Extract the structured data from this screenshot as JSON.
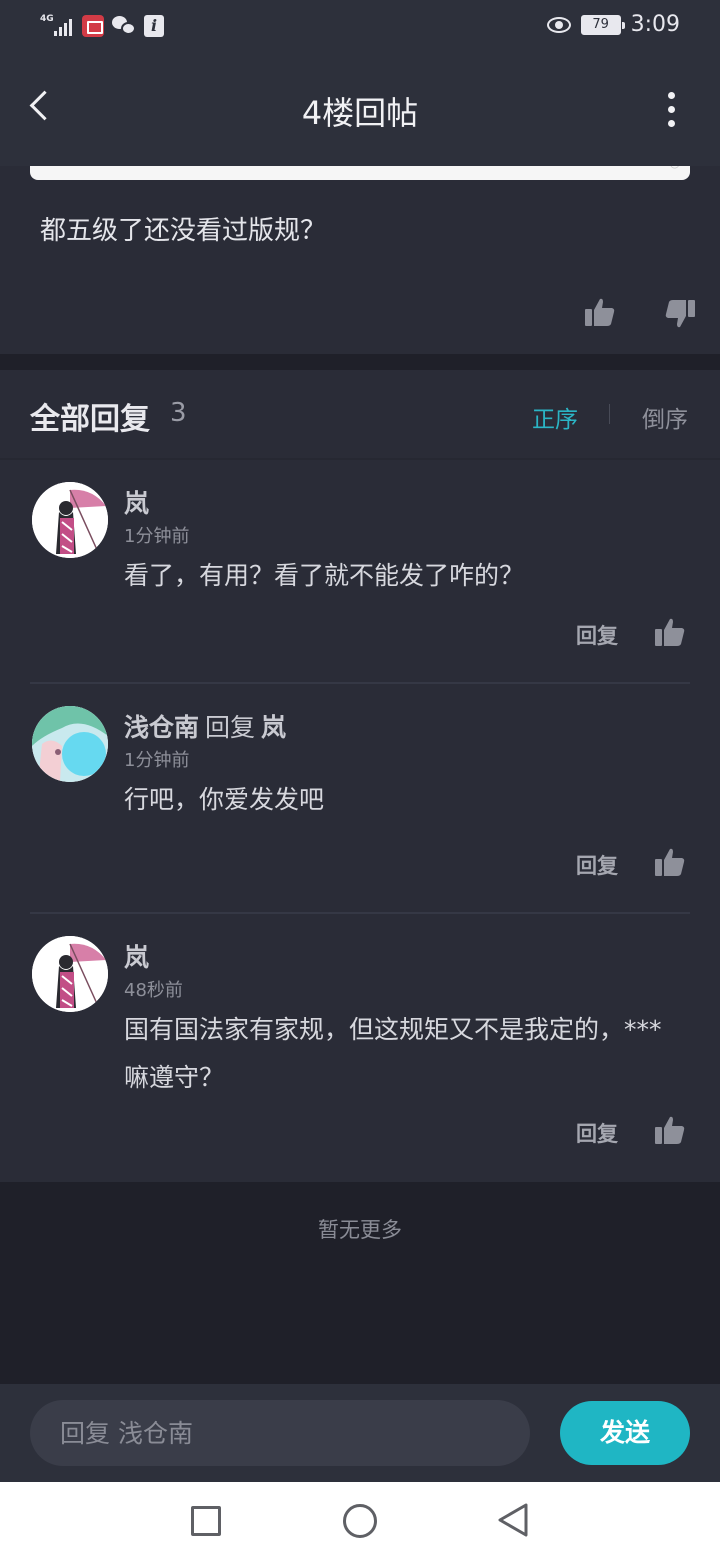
{
  "status_bar": {
    "network": "4G",
    "battery": "79",
    "time": "3:09"
  },
  "header": {
    "title": "4楼回帖"
  },
  "post": {
    "text": "都五级了还没看过版规？"
  },
  "replies_section": {
    "label": "全部回复",
    "count": "3",
    "sort_asc": "正序",
    "sort_desc": "倒序"
  },
  "replies": [
    {
      "author": "岚",
      "reply_to_word": "",
      "reply_to": "",
      "time": "1分钟前",
      "text": "看了，有用？看了就不能发了咋的？",
      "reply_label": "回复",
      "avatar_icon": "anime-girl-umbrella-avatar"
    },
    {
      "author": "浅仓南",
      "reply_to_word": "回复",
      "reply_to": "岚",
      "time": "1分钟前",
      "text": "行吧，你爱发发吧",
      "reply_label": "回复",
      "avatar_icon": "anime-boy-teal-avatar"
    },
    {
      "author": "岚",
      "reply_to_word": "",
      "reply_to": "",
      "time": "48秒前",
      "text": "国有国法家有家规，但这规矩又不是我定的，***嘛遵守？",
      "reply_label": "回复",
      "avatar_icon": "anime-girl-umbrella-avatar"
    }
  ],
  "footer": {
    "no_more": "暂无更多"
  },
  "input_bar": {
    "placeholder": "回复 浅仓南",
    "send_label": "发送"
  },
  "colors": {
    "accent": "#1fb6c4",
    "background": "#1f2029",
    "card": "#2a2c37",
    "header": "#2d303b"
  }
}
